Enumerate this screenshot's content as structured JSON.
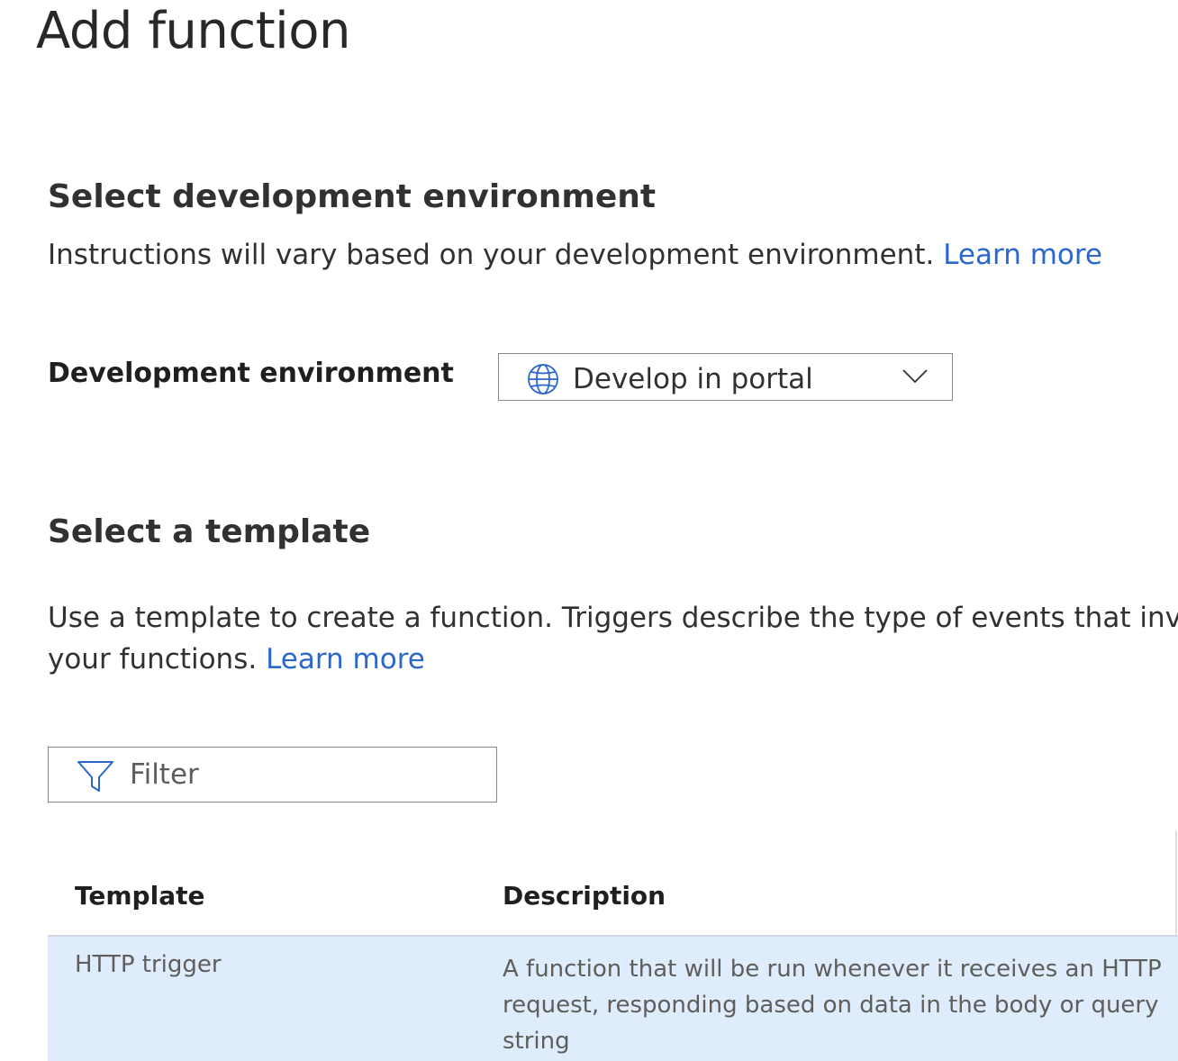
{
  "page": {
    "title": "Add function"
  },
  "dev_environment": {
    "heading": "Select development environment",
    "description": "Instructions will vary based on your development environment.",
    "learn_more": "Learn more",
    "field_label": "Development environment",
    "selected_value": "Develop in portal",
    "selected_icon": "globe-icon",
    "dropdown_icon": "chevron-down-icon"
  },
  "template_section": {
    "heading": "Select a template",
    "description_line1": "Use a template to create a function. Triggers describe the type of events that invo",
    "description_line2": "your functions.",
    "learn_more": "Learn more"
  },
  "filter": {
    "placeholder": "Filter",
    "icon": "filter-icon"
  },
  "table": {
    "columns": [
      "Template",
      "Description"
    ],
    "rows": [
      {
        "template": "HTTP trigger",
        "description_lines": [
          "A function that will be run whenever it receives an HTTP",
          "request, responding based on data in the body or query",
          "string"
        ],
        "selected": true
      }
    ]
  },
  "colors": {
    "link": "#2b67cc",
    "selected_row_bg": "#deecfc",
    "border": "#8a8886",
    "icon_accent": "#2b67cc"
  }
}
